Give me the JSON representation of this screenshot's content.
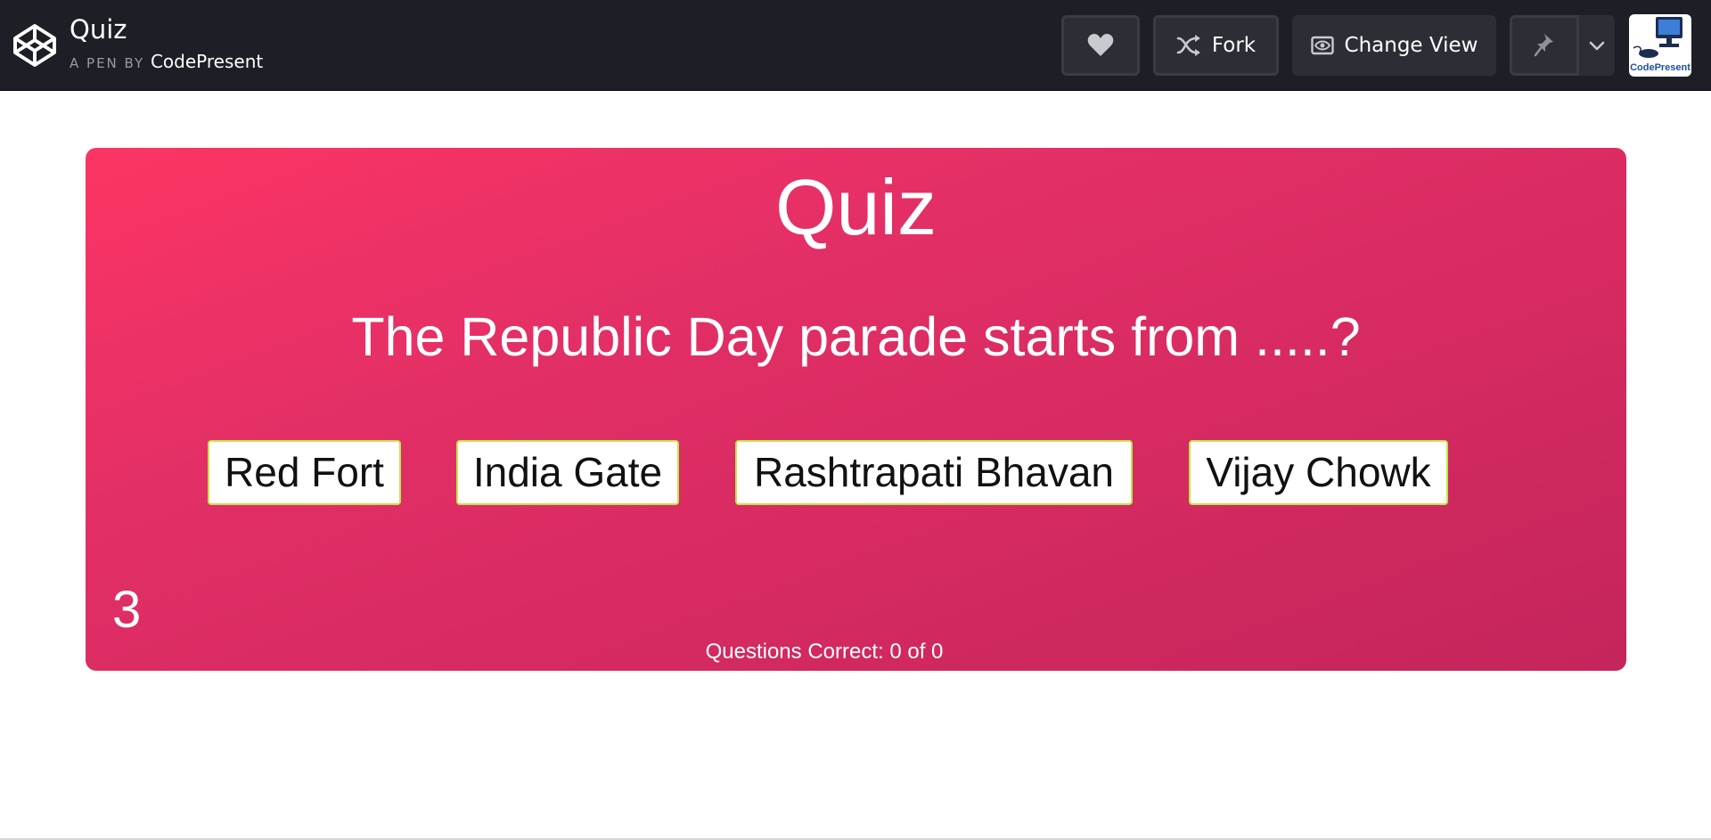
{
  "header": {
    "title": "Quiz",
    "pen_by": "A PEN BY",
    "author": "CodePresent",
    "fork_label": "Fork",
    "change_view_label": "Change View",
    "avatar_label": "CodePresent"
  },
  "quiz": {
    "title": "Quiz",
    "question": "The Republic Day parade starts from .....?",
    "answers": [
      "Red Fort",
      "India Gate",
      "Rashtrapati Bhavan",
      "Vijay Chowk"
    ],
    "timer": "3",
    "score": "Questions Correct: 0 of 0"
  },
  "colors": {
    "topbar": "#1e1f26",
    "card_start": "#fc3464",
    "card_end": "#c3255c",
    "answer_border": "#bde64a"
  }
}
